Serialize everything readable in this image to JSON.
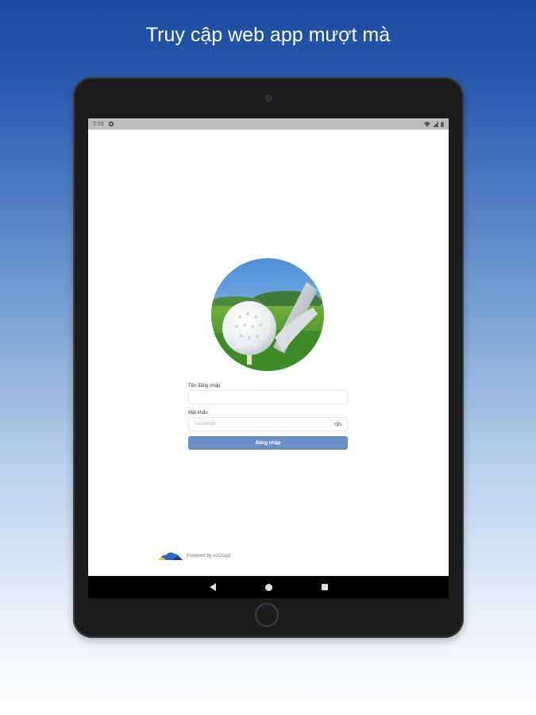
{
  "headline": "Truy cập web app mượt mà",
  "status_bar": {
    "time": "5:55",
    "icons": [
      "settings-icon",
      "wifi-icon",
      "signal-icon",
      "battery-icon"
    ]
  },
  "login": {
    "username_label": "Tên đăng nhập",
    "username_value": "",
    "password_label": "Mật khẩu",
    "password_placeholder": "Password",
    "submit_label": "Đăng nhập"
  },
  "footer": {
    "powered_by": "Powered by ezCloud"
  },
  "colors": {
    "accent_button": "#6b8ec7",
    "background_top": "#1a4aa0",
    "tablet_frame": "#1b1c1e"
  }
}
